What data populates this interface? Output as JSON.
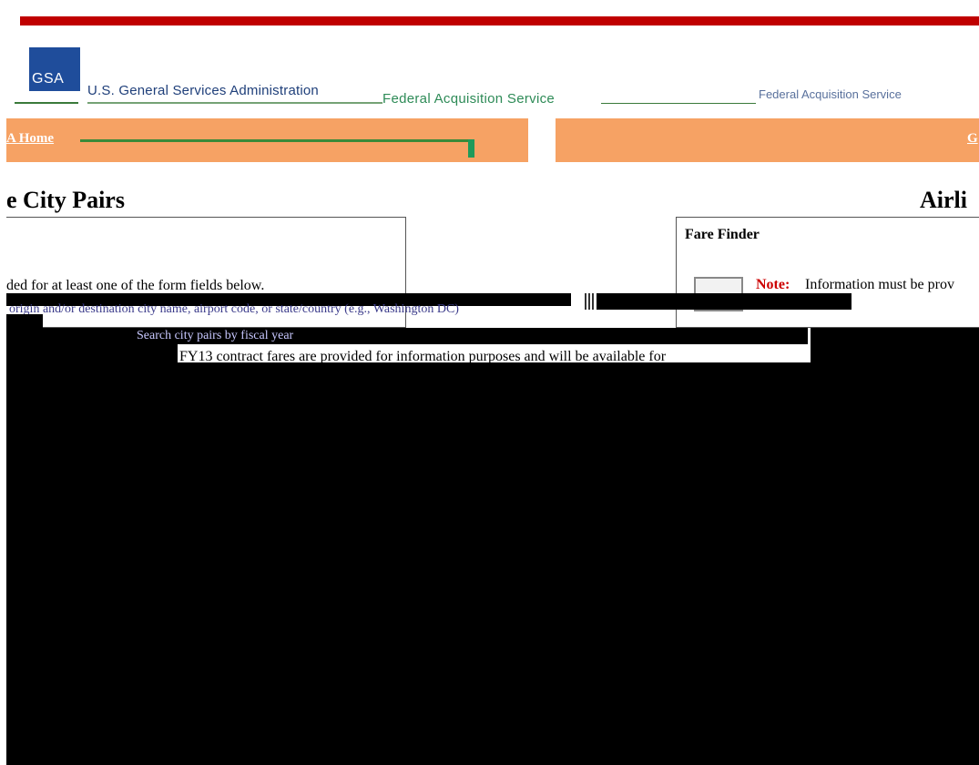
{
  "header": {
    "logo_text": "GSA",
    "agency_name": "U.S. General Services Administration",
    "service_name": "Federal Acquisition Service",
    "service_name_right": "Federal Acquisition Service"
  },
  "nav": {
    "home_link": "A Home",
    "right_link": "G"
  },
  "main": {
    "page_title": "e City Pairs",
    "right_title": "Airli"
  },
  "form_panel": {
    "requirement_text": "ded for at least one of the form fields below."
  },
  "fare_finder": {
    "title": "Fare Finder",
    "note_label": "Note:",
    "note_text": "Information must be prov"
  },
  "notices": {
    "fy13_text": "FY13 contract fares are provided for information purposes and will be available for",
    "garbled_line": "origin and/or destination city name, airport code, or state/country (e.g., Washington DC)",
    "garbled_line2": "Search city pairs by fiscal year"
  },
  "colors": {
    "red_bar": "#c00000",
    "nav_orange": "#f6a264",
    "logo_blue": "#1f4d9b",
    "note_red": "#cc0000"
  }
}
